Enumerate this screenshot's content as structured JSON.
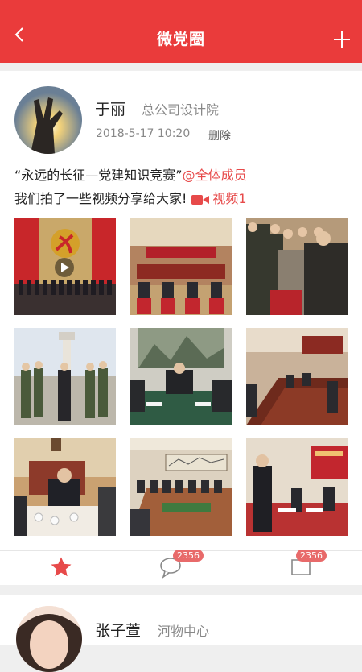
{
  "header": {
    "title": "微党圈",
    "back_icon": "chevron-left-icon",
    "add_icon": "plus-icon",
    "bg_color": "#ea3b3b"
  },
  "post": {
    "author": "于丽",
    "department": "总公司设计院",
    "time": "2018-5-17 10:20",
    "delete_label": "删除",
    "line1_text": "“永远的长征—党建知识竞赛”",
    "mention": "@全体成员",
    "line2_text": "我们拍了一些视频分享给大家!",
    "video_label": "视频1",
    "photos": [
      "party-emblem-stage",
      "meeting-hall",
      "handshake",
      "soldiers-walk",
      "meeting-table",
      "conference-room",
      "office-meeting",
      "large-meeting",
      "signing-ceremony"
    ],
    "actions": {
      "star_icon": "star-icon",
      "comment_count": "2356",
      "share_count": "2356"
    }
  },
  "post2": {
    "author": "张子萱",
    "department": "河物中心"
  },
  "colors": {
    "accent": "#e74a4a",
    "badge": "#e86a6a"
  }
}
